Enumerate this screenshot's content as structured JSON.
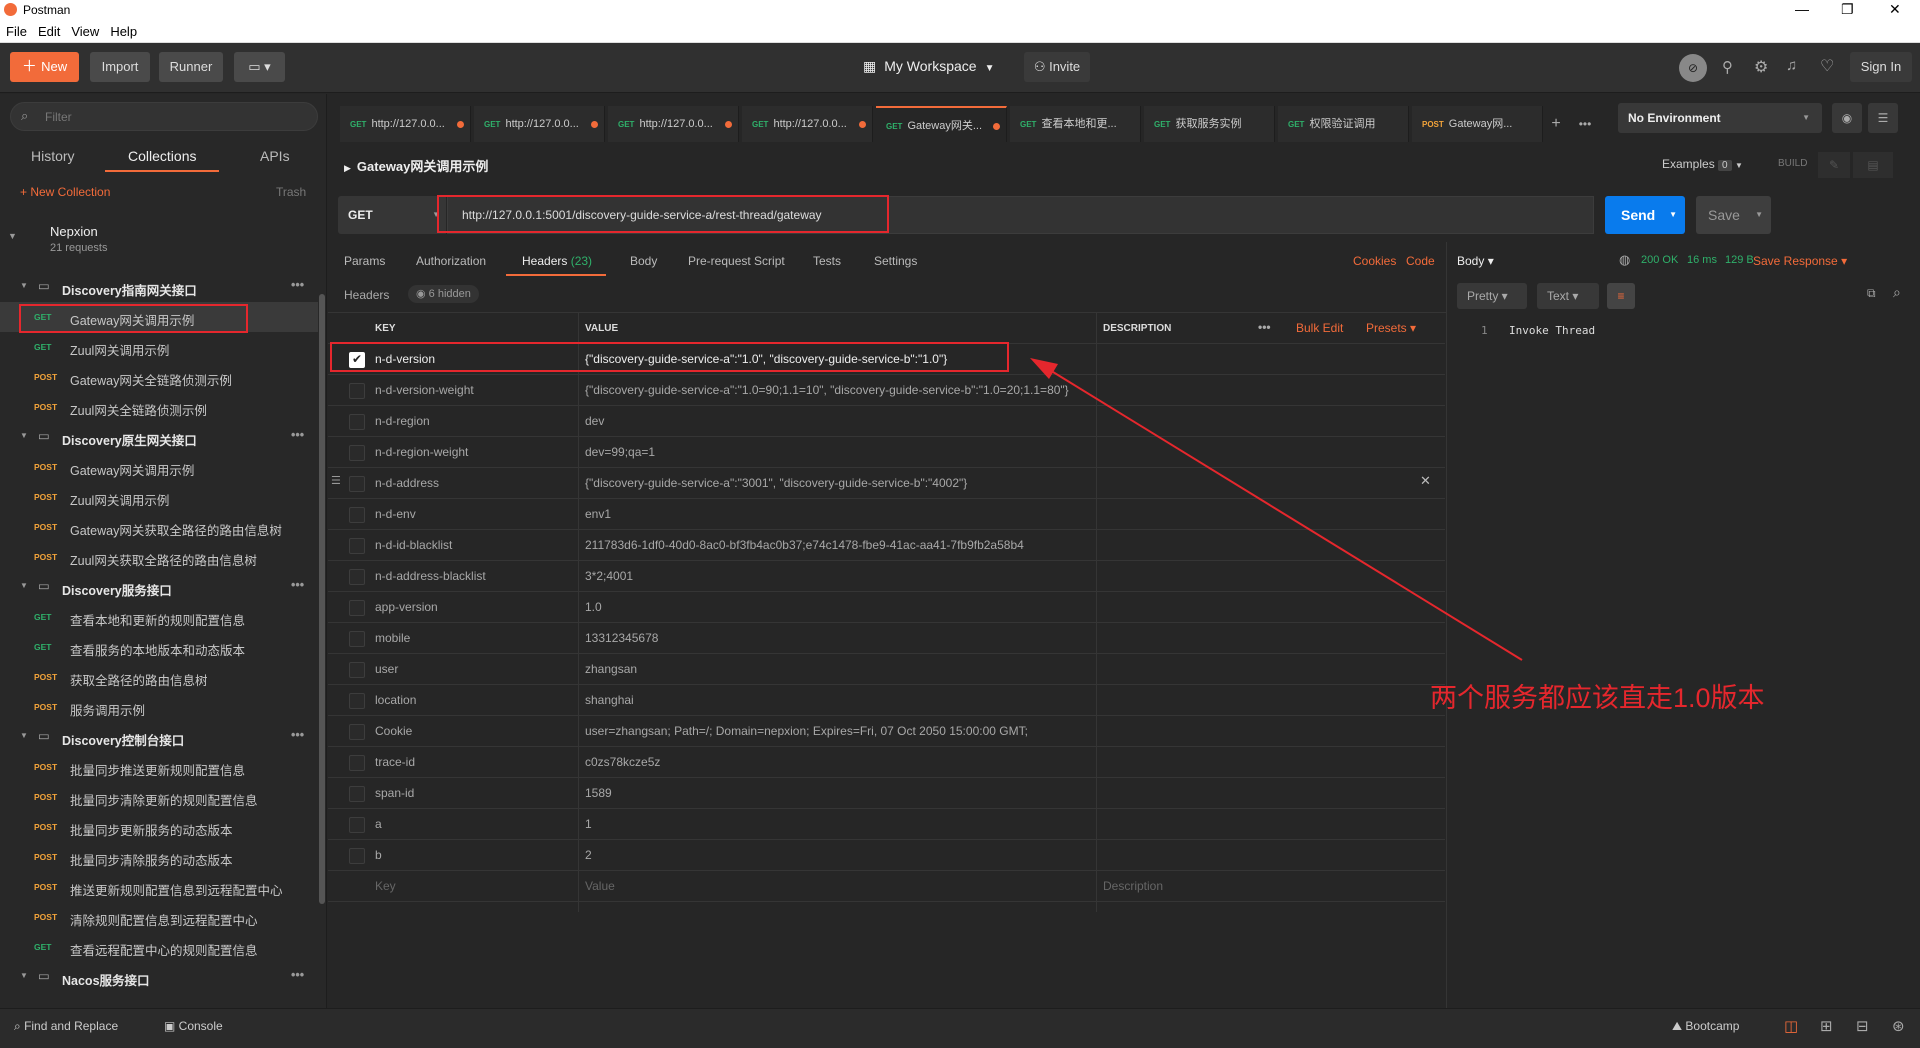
{
  "window": {
    "title": "Postman",
    "menu": [
      "File",
      "Edit",
      "View",
      "Help"
    ]
  },
  "header": {
    "new": "New",
    "import": "Import",
    "runner": "Runner",
    "workspace": "My Workspace",
    "invite": "Invite",
    "sign_in": "Sign In"
  },
  "sidebar": {
    "filter_placeholder": "Filter",
    "tabs": [
      "History",
      "Collections",
      "APIs"
    ],
    "new_collection": "New Collection",
    "trash": "Trash",
    "collection_name": "Nepxion",
    "collection_count": "21 requests",
    "items": [
      {
        "type": "folder",
        "label": "Discovery指南网关接口"
      },
      {
        "type": "req",
        "method": "GET",
        "label": "Gateway网关调用示例"
      },
      {
        "type": "req",
        "method": "GET",
        "label": "Zuul网关调用示例"
      },
      {
        "type": "req",
        "method": "POST",
        "label": "Gateway网关全链路侦测示例"
      },
      {
        "type": "req",
        "method": "POST",
        "label": "Zuul网关全链路侦测示例"
      },
      {
        "type": "folder",
        "label": "Discovery原生网关接口"
      },
      {
        "type": "req",
        "method": "POST",
        "label": "Gateway网关调用示例"
      },
      {
        "type": "req",
        "method": "POST",
        "label": "Zuul网关调用示例"
      },
      {
        "type": "req",
        "method": "POST",
        "label": "Gateway网关获取全路径的路由信息树"
      },
      {
        "type": "req",
        "method": "POST",
        "label": "Zuul网关获取全路径的路由信息树"
      },
      {
        "type": "folder",
        "label": "Discovery服务接口"
      },
      {
        "type": "req",
        "method": "GET",
        "label": "查看本地和更新的规则配置信息"
      },
      {
        "type": "req",
        "method": "GET",
        "label": "查看服务的本地版本和动态版本"
      },
      {
        "type": "req",
        "method": "POST",
        "label": "获取全路径的路由信息树"
      },
      {
        "type": "req",
        "method": "POST",
        "label": "服务调用示例"
      },
      {
        "type": "folder",
        "label": "Discovery控制台接口"
      },
      {
        "type": "req",
        "method": "POST",
        "label": "批量同步推送更新规则配置信息"
      },
      {
        "type": "req",
        "method": "POST",
        "label": "批量同步清除更新的规则配置信息"
      },
      {
        "type": "req",
        "method": "POST",
        "label": "批量同步更新服务的动态版本"
      },
      {
        "type": "req",
        "method": "POST",
        "label": "批量同步清除服务的动态版本"
      },
      {
        "type": "req",
        "method": "POST",
        "label": "推送更新规则配置信息到远程配置中心"
      },
      {
        "type": "req",
        "method": "POST",
        "label": "清除规则配置信息到远程配置中心"
      },
      {
        "type": "req",
        "method": "GET",
        "label": "查看远程配置中心的规则配置信息"
      },
      {
        "type": "folder",
        "label": "Nacos服务接口"
      }
    ]
  },
  "tabs": [
    {
      "method": "GET",
      "label": "http://127.0.0...",
      "dot": true
    },
    {
      "method": "GET",
      "label": "http://127.0.0...",
      "dot": true
    },
    {
      "method": "GET",
      "label": "http://127.0.0...",
      "dot": true
    },
    {
      "method": "GET",
      "label": "http://127.0.0...",
      "dot": true
    },
    {
      "method": "GET",
      "label": "Gateway网关...",
      "dot": true
    },
    {
      "method": "GET",
      "label": "查看本地和更...",
      "dot": false
    },
    {
      "method": "GET",
      "label": "获取服务实例",
      "dot": false
    },
    {
      "method": "GET",
      "label": "权限验证调用",
      "dot": false
    },
    {
      "method": "POST",
      "label": "Gateway网...",
      "dot": false
    }
  ],
  "environment": "No Environment",
  "request": {
    "name": "Gateway网关调用示例",
    "examples": "Examples",
    "examples_count": "0",
    "build": "BUILD",
    "method": "GET",
    "url": "http://127.0.0.1:5001/discovery-guide-service-a/rest-thread/gateway",
    "send": "Send",
    "save": "Save"
  },
  "req_tabs": {
    "params": "Params",
    "auth": "Authorization",
    "headers": "Headers",
    "headers_count": "(23)",
    "body": "Body",
    "pre": "Pre-request Script",
    "tests": "Tests",
    "settings": "Settings",
    "cookies": "Cookies",
    "code": "Code"
  },
  "headers_bar": {
    "label": "Headers",
    "hidden": "6 hidden"
  },
  "table": {
    "key": "KEY",
    "value": "VALUE",
    "description": "DESCRIPTION",
    "bulk": "Bulk Edit",
    "presets": "Presets",
    "rows": [
      {
        "k": "n-d-version",
        "v": "{\"discovery-guide-service-a\":\"1.0\", \"discovery-guide-service-b\":\"1.0\"}",
        "on": true
      },
      {
        "k": "n-d-version-weight",
        "v": "{\"discovery-guide-service-a\":\"1.0=90;1.1=10\", \"discovery-guide-service-b\":\"1.0=20;1.1=80\"}",
        "on": false
      },
      {
        "k": "n-d-region",
        "v": "dev",
        "on": false
      },
      {
        "k": "n-d-region-weight",
        "v": "dev=99;qa=1",
        "on": false
      },
      {
        "k": "n-d-address",
        "v": "{\"discovery-guide-service-a\":\"3001\", \"discovery-guide-service-b\":\"4002\"}",
        "on": false
      },
      {
        "k": "n-d-env",
        "v": "env1",
        "on": false
      },
      {
        "k": "n-d-id-blacklist",
        "v": "211783d6-1df0-40d0-8ac0-bf3fb4ac0b37;e74c1478-fbe9-41ac-aa41-7fb9fb2a58b4",
        "on": false
      },
      {
        "k": "n-d-address-blacklist",
        "v": "3*2;4001",
        "on": false
      },
      {
        "k": "app-version",
        "v": "1.0",
        "on": false
      },
      {
        "k": "mobile",
        "v": "13312345678",
        "on": false
      },
      {
        "k": "user",
        "v": "zhangsan",
        "on": false
      },
      {
        "k": "location",
        "v": "shanghai",
        "on": false
      },
      {
        "k": "Cookie",
        "v": "user=zhangsan; Path=/; Domain=nepxion; Expires=Fri, 07 Oct 2050 15:00:00 GMT;",
        "on": false
      },
      {
        "k": "trace-id",
        "v": "c0zs78kcze5z",
        "on": false
      },
      {
        "k": "span-id",
        "v": "1589",
        "on": false
      },
      {
        "k": "a",
        "v": "1",
        "on": false
      },
      {
        "k": "b",
        "v": "2",
        "on": false
      }
    ],
    "placeholder_key": "Key",
    "placeholder_value": "Value",
    "placeholder_desc": "Description"
  },
  "response": {
    "body": "Body",
    "status": "200 OK",
    "time": "16 ms",
    "size": "129 B",
    "save": "Save Response",
    "pretty": "Pretty",
    "text": "Text",
    "line_no": "1",
    "content": "Invoke Thread"
  },
  "annotation": "两个服务都应该直走1.0版本",
  "footer": {
    "find": "Find and Replace",
    "console": "Console",
    "bootcamp": "Bootcamp"
  },
  "colors": {
    "accent": "#f26b3a",
    "send": "#097bed",
    "annotation": "#e5272d"
  }
}
